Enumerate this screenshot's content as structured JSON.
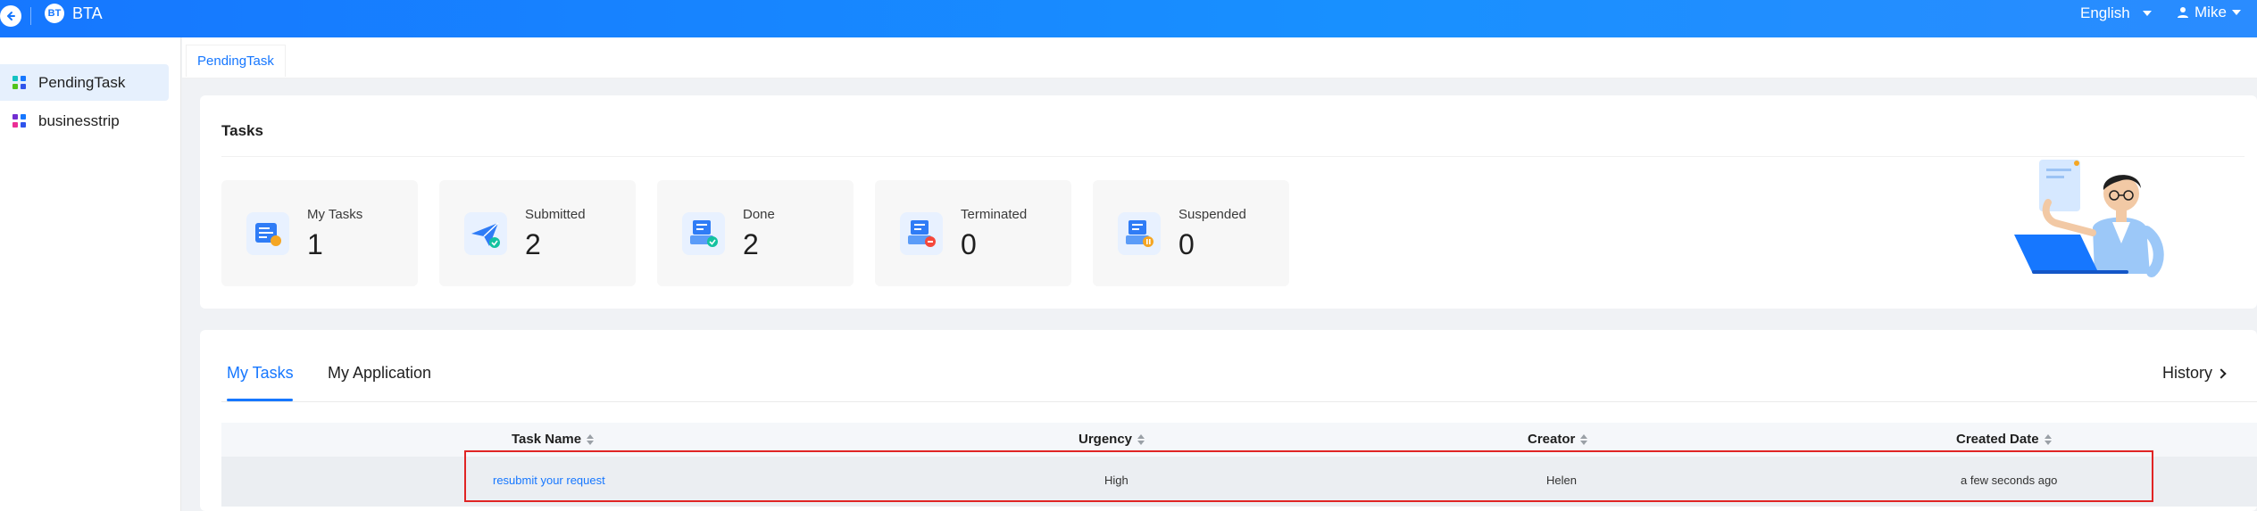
{
  "header": {
    "app_title": "BTA",
    "logo_text": "BT",
    "language": "English",
    "user": "Mike"
  },
  "sidebar": {
    "items": [
      {
        "label": "PendingTask",
        "icon": "grid-icon",
        "active": true,
        "colors": [
          "#13c2c2",
          "#1677ff",
          "#52c41a",
          "#2f54eb"
        ]
      },
      {
        "label": "businesstrip",
        "icon": "grid-icon",
        "active": false,
        "colors": [
          "#722ed1",
          "#1677ff",
          "#eb2f96",
          "#2f54eb"
        ]
      }
    ]
  },
  "page_tab": {
    "label": "PendingTask"
  },
  "tasks": {
    "title": "Tasks",
    "stats": [
      {
        "label": "My Tasks",
        "value": "1",
        "icon": "task-list-icon"
      },
      {
        "label": "Submitted",
        "value": "2",
        "icon": "paper-plane-icon"
      },
      {
        "label": "Done",
        "value": "2",
        "icon": "done-check-icon"
      },
      {
        "label": "Terminated",
        "value": "0",
        "icon": "terminated-icon"
      },
      {
        "label": "Suspended",
        "value": "0",
        "icon": "suspended-icon"
      }
    ]
  },
  "list": {
    "tabs": [
      {
        "label": "My Tasks",
        "active": true
      },
      {
        "label": "My Application",
        "active": false
      }
    ],
    "history_label": "History",
    "columns": [
      "Task Name",
      "Urgency",
      "Creator",
      "Created Date"
    ],
    "rows": [
      {
        "task_name": "resubmit your request",
        "urgency": "High",
        "creator": "Helen",
        "created_date": "a few seconds ago"
      }
    ]
  },
  "colors": {
    "primary": "#1677ff",
    "highlight": "#e02424"
  }
}
